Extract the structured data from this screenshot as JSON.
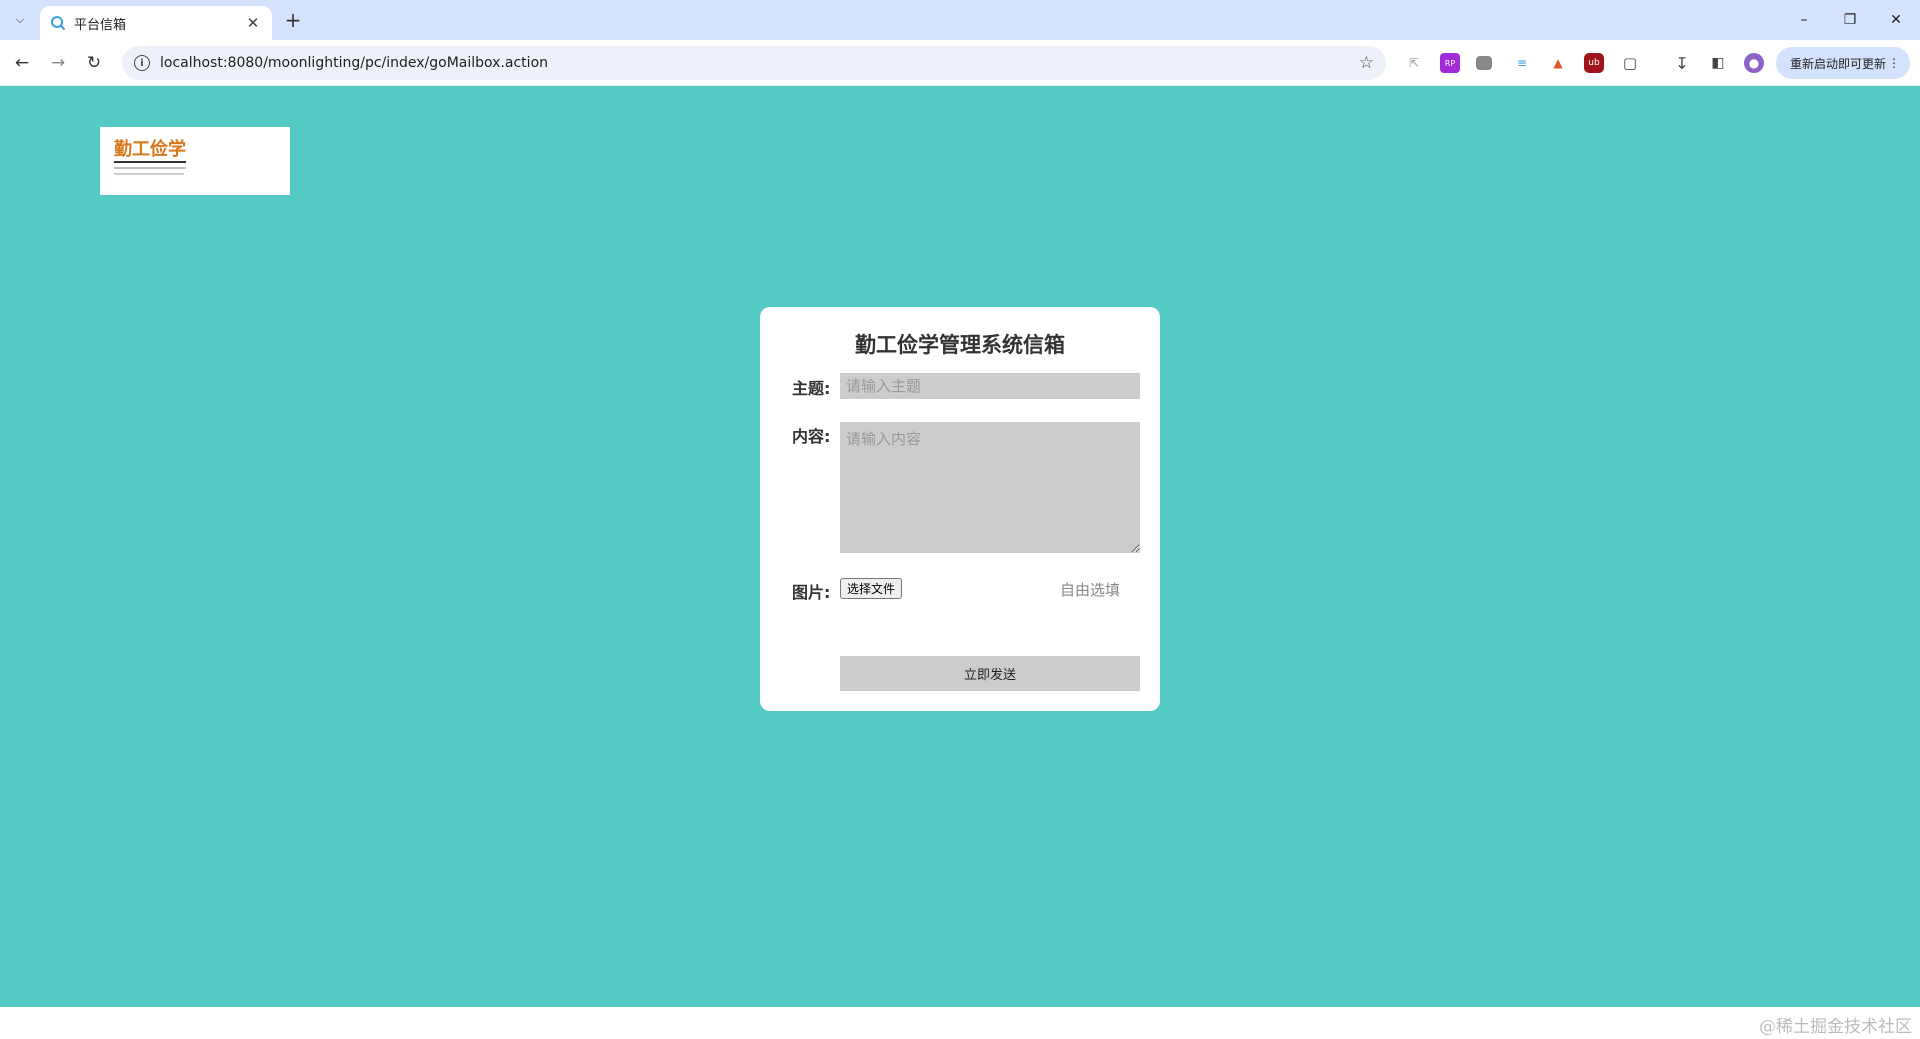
{
  "browser": {
    "tab_title": "平台信箱",
    "url": "localhost:8080/moonlighting/pc/index/goMailbox.action",
    "update_button_label": "重新启动即可更新",
    "accent_color": "#d3e3fd"
  },
  "logo": {
    "brand_text": "勤工俭学"
  },
  "mailbox": {
    "title": "勤工俭学管理系统信箱",
    "subject_label": "主题:",
    "subject_placeholder": "请输入主题",
    "content_label": "内容:",
    "content_placeholder": "请输入内容",
    "image_label": "图片:",
    "file_button_label": "选择文件",
    "optional_hint": "自由选填",
    "send_button_label": "立即发送",
    "background_color": "#53cbc4"
  },
  "watermark": "@稀土掘金技术社区"
}
